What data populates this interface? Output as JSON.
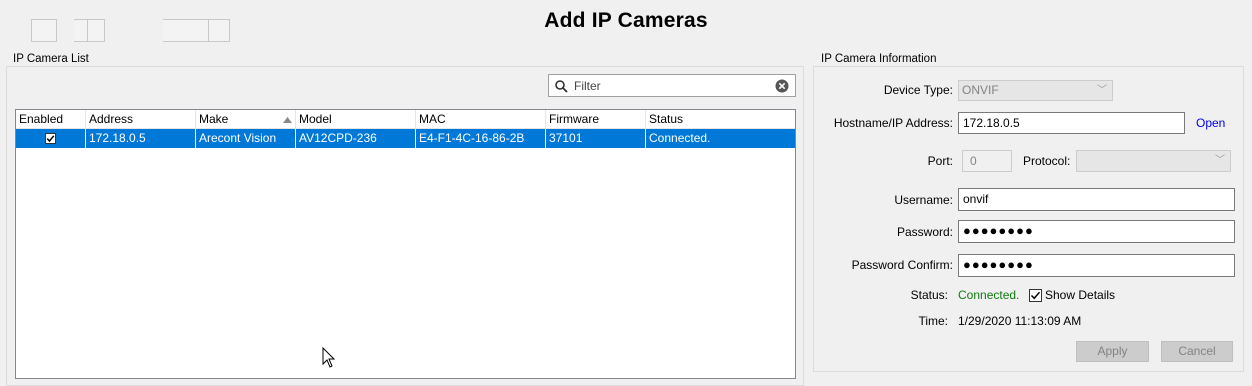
{
  "window": {
    "title": "Add IP Cameras"
  },
  "camera_list": {
    "legend": "IP Camera List",
    "filter_placeholder": "Filter",
    "columns": [
      "Enabled",
      "Address",
      "Make",
      "Model",
      "MAC",
      "Firmware",
      "Status"
    ],
    "sorted_column": "Make",
    "rows": [
      {
        "enabled": true,
        "address": "172.18.0.5",
        "make": "Arecont Vision",
        "model": "AV12CPD-236",
        "mac": "E4-F1-4C-16-86-2B",
        "firmware": "37101",
        "status": "Connected."
      }
    ]
  },
  "info": {
    "legend": "IP Camera Information",
    "device_type_label": "Device Type:",
    "device_type_value": "ONVIF",
    "hostname_label": "Hostname/IP Address:",
    "hostname_value": "172.18.0.5",
    "open_link": "Open",
    "port_label": "Port:",
    "port_value": "0",
    "protocol_label": "Protocol:",
    "protocol_value": "",
    "username_label": "Username:",
    "username_value": "onvif",
    "password_label": "Password:",
    "password_value": "●●●●●●●●",
    "password_confirm_label": "Password Confirm:",
    "password_confirm_value": "●●●●●●●●",
    "status_label": "Status:",
    "status_value": "Connected.",
    "show_details_label": "Show Details",
    "show_details_checked": true,
    "time_label": "Time:",
    "time_value": "1/29/2020 11:13:09 AM",
    "apply_label": "Apply",
    "cancel_label": "Cancel"
  },
  "colors": {
    "selection": "#0078d7",
    "status_ok": "#107c10",
    "link": "#0000ee"
  }
}
